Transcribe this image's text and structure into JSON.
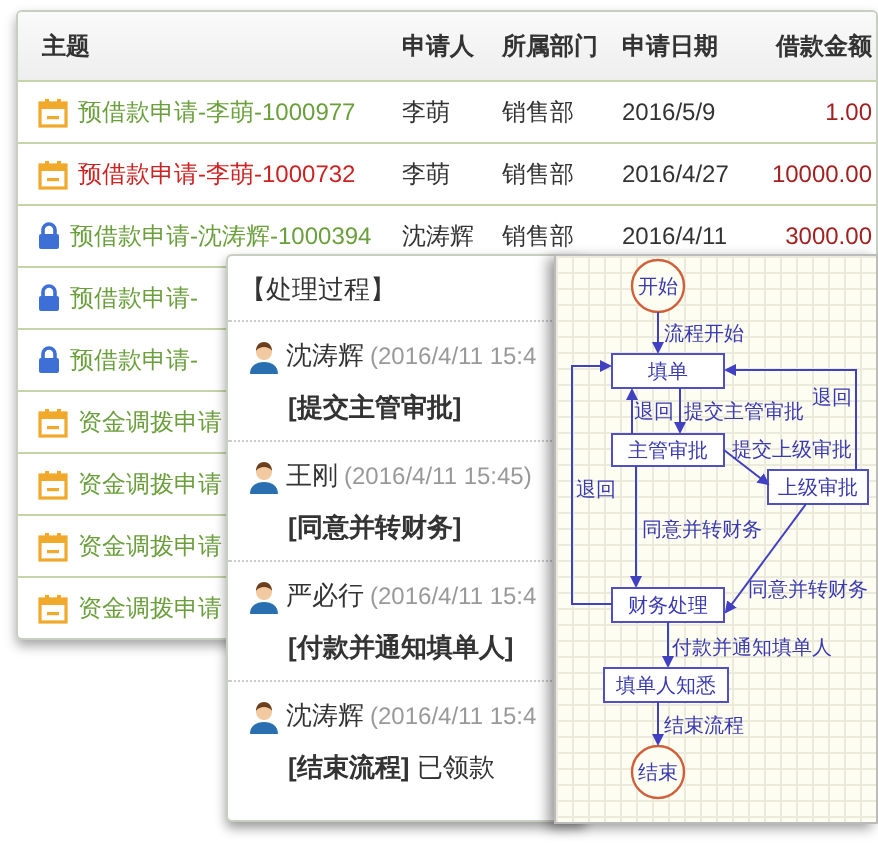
{
  "table": {
    "columns": [
      "主题",
      "申请人",
      "所属部门",
      "申请日期",
      "借款金额"
    ],
    "rows": [
      {
        "kind": "calendar",
        "title": "预借款申请-李萌-1000977",
        "color": "#6a9f3c",
        "applicant": "李萌",
        "department": "销售部",
        "date": "2016/5/9",
        "amount": "1.00"
      },
      {
        "kind": "calendar",
        "title": "预借款申请-李萌-1000732",
        "color": "#cc2222",
        "applicant": "李萌",
        "department": "销售部",
        "date": "2016/4/27",
        "amount": "10000.00"
      },
      {
        "kind": "lock",
        "title": "预借款申请-沈涛辉-1000394",
        "color": "#6a9f3c",
        "applicant": "沈涛辉",
        "department": "销售部",
        "date": "2016/4/11",
        "amount": "3000.00"
      },
      {
        "kind": "lock",
        "title": "预借款申请-",
        "color": "#6a9f3c"
      },
      {
        "kind": "lock",
        "title": "预借款申请-",
        "color": "#6a9f3c"
      },
      {
        "kind": "calendar",
        "title": "资金调拨申请",
        "color": "#6a9f3c"
      },
      {
        "kind": "calendar",
        "title": "资金调拨申请",
        "color": "#6a9f3c"
      },
      {
        "kind": "calendar",
        "title": "资金调拨申请",
        "color": "#6a9f3c"
      },
      {
        "kind": "calendar",
        "title": "资金调拨申请",
        "color": "#6a9f3c"
      }
    ]
  },
  "process_popup": {
    "title": "【处理过程】",
    "entries": [
      {
        "name": "沈涛辉",
        "time": "(2016/4/11 15:4",
        "action": "**[提交主管审批]**"
      },
      {
        "name": "王刚",
        "time": "(2016/4/11 15:45)",
        "action": "**[同意并转财务]**"
      },
      {
        "name": "严必行",
        "time": "(2016/4/11 15:4",
        "action": "**[付款并通知填单人]**"
      },
      {
        "name": "沈涛辉",
        "time": "(2016/4/11 15:4",
        "action": "**[结束流程]** 已领款"
      }
    ]
  },
  "flowchart": {
    "nodes": [
      {
        "kind": "terminal",
        "label": "开始"
      },
      {
        "kind": "step",
        "label": "填单"
      },
      {
        "kind": "step",
        "label": "主管审批"
      },
      {
        "kind": "step",
        "label": "上级审批"
      },
      {
        "kind": "step",
        "label": "财务处理"
      },
      {
        "kind": "step",
        "label": "填单人知悉"
      },
      {
        "kind": "terminal",
        "label": "结束"
      }
    ],
    "edges": [
      {
        "label": "流程开始"
      },
      {
        "label": "退回"
      },
      {
        "label": "提交主管审批"
      },
      {
        "label": "退回"
      },
      {
        "label": "提交上级审批"
      },
      {
        "label": "退回"
      },
      {
        "label": "同意并转财务"
      },
      {
        "label": "同意并转财务"
      },
      {
        "label": "付款并通知填单人"
      },
      {
        "label": "结束流程"
      }
    ]
  }
}
